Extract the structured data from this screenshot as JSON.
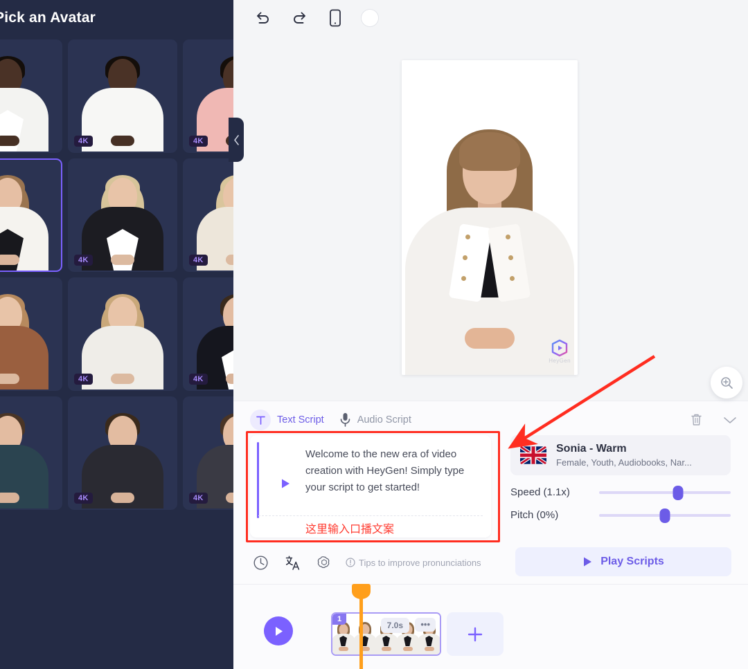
{
  "sidebar": {
    "title": "Pick an Avatar",
    "collapse_icon": "chevron-left-icon",
    "badge_label": "4K",
    "avatars": [
      {
        "id": "a1",
        "skin": "#4A3226",
        "hair": "#140E0A",
        "body": "#F3F3F1",
        "inner": "#FFFFFF",
        "tie": "",
        "style": "shirt",
        "selected": false
      },
      {
        "id": "a2",
        "skin": "#4A3226",
        "hair": "#140E0A",
        "body": "#F7F7F5",
        "inner": "#F7F7F5",
        "tie": "",
        "style": "vneck",
        "selected": false
      },
      {
        "id": "a3",
        "skin": "#4A3226",
        "hair": "#140E0A",
        "body": "#F0B8B4",
        "inner": "#F0B8B4",
        "tie": "",
        "style": "tee",
        "selected": false
      },
      {
        "id": "a4",
        "skin": "#E6BFA4",
        "hair": "#9A7450",
        "body": "#F5F3EF",
        "inner": "#18181D",
        "tie": "",
        "style": "blazer",
        "selected": true
      },
      {
        "id": "a5",
        "skin": "#E8C4A8",
        "hair": "#D7C49A",
        "body": "#1C1C22",
        "inner": "#FFFFFF",
        "tie": "",
        "style": "blazer",
        "selected": false
      },
      {
        "id": "a6",
        "skin": "#E8C4A8",
        "hair": "#D9C59C",
        "body": "#EDE6DA",
        "inner": "#EDE6DA",
        "tie": "",
        "style": "blouse",
        "selected": false
      },
      {
        "id": "a7",
        "skin": "#E8C4A8",
        "hair": "#B78A5E",
        "body": "#9A5F3F",
        "inner": "#9A5F3F",
        "tie": "",
        "style": "tee",
        "selected": false
      },
      {
        "id": "a8",
        "skin": "#E8C4A8",
        "hair": "#C9A87A",
        "body": "#EFEDE8",
        "inner": "#EFEDE8",
        "tie": "",
        "style": "tee",
        "selected": false
      },
      {
        "id": "a9",
        "skin": "#E3BCA1",
        "hair": "#3A2A1C",
        "body": "#15161E",
        "inner": "#FFFFFF",
        "tie": "#C8202C",
        "style": "suit",
        "selected": false
      },
      {
        "id": "a10",
        "skin": "#E3BCA1",
        "hair": "#4A3526",
        "body": "#2B4450",
        "inner": "#2B4450",
        "tie": "",
        "style": "polo",
        "selected": false
      },
      {
        "id": "a11",
        "skin": "#E3BCA1",
        "hair": "#3A2A1C",
        "body": "#2A2A32",
        "inner": "#2A2A32",
        "tie": "",
        "style": "tee",
        "selected": false
      },
      {
        "id": "a12",
        "skin": "#E3BCA1",
        "hair": "#4A3526",
        "body": "#3A3A44",
        "inner": "#3A3A44",
        "tie": "",
        "style": "tee",
        "selected": false
      }
    ]
  },
  "toolbar": {
    "undo_icon": "undo-icon",
    "redo_icon": "redo-icon",
    "device_icon": "mobile-device-icon",
    "color_swatch_icon": "color-swatch-icon",
    "color_swatch_value": "#FFFFFF"
  },
  "canvas": {
    "watermark_text": "HeyGen",
    "zoom_icon": "zoom-in-icon"
  },
  "script_panel": {
    "tabs": [
      {
        "label": "Text Script",
        "icon": "text-script-icon",
        "active": true
      },
      {
        "label": "Audio Script",
        "icon": "microphone-icon",
        "active": false
      }
    ],
    "delete_icon": "trash-icon",
    "collapse_icon": "chevron-down-icon",
    "script_play_icon": "play-triangle-icon",
    "script_text": "Welcome to the new era of video creation with HeyGen! Simply type your script to get started!",
    "annotation_text": "这里输入口播文案",
    "highlight_color": "#FF2D20"
  },
  "voice": {
    "flag_icon": "uk-flag-icon",
    "name": "Sonia - Warm",
    "description": "Female, Youth, Audiobooks, Nar...",
    "speed_label": "Speed (1.1x)",
    "speed_percent": 60,
    "pitch_label": "Pitch (0%)",
    "pitch_percent": 50
  },
  "bottom_bar": {
    "history_icon": "clock-icon",
    "translate_icon": "translate-icon",
    "ai_icon": "openai-spiral-icon",
    "info_icon": "info-circle-icon",
    "tips_label": "Tips to improve pronunciations",
    "play_icon": "play-triangle-icon",
    "play_label": "Play Scripts"
  },
  "timeline": {
    "play_icon": "play-circle-icon",
    "clip_number": "1",
    "clip_duration": "7.0s",
    "clip_more_icon": "more-horizontal-icon",
    "add_scene_icon": "plus-icon",
    "playhead_icon": "playhead-marker",
    "playhead_color": "#FF9F1C"
  },
  "annotation": {
    "arrow_color": "#FF2D20"
  }
}
